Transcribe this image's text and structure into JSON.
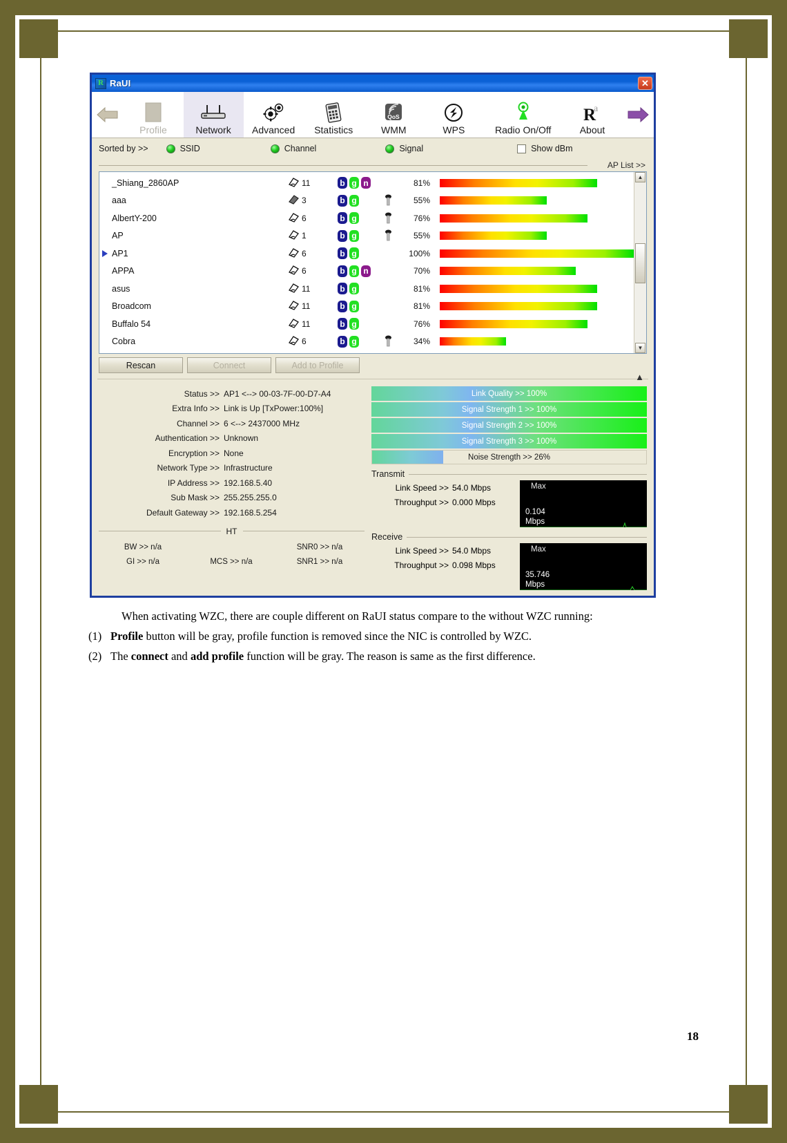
{
  "window": {
    "title": "RaUI",
    "icon": "raui-app-icon",
    "close_label": "✕"
  },
  "toolbar": {
    "back_icon": "back-arrow-icon",
    "forward_icon": "forward-arrow-icon",
    "items": [
      {
        "label": "Profile",
        "icon": "profile-icon",
        "state": "disabled"
      },
      {
        "label": "Network",
        "icon": "network-icon",
        "state": "selected"
      },
      {
        "label": "Advanced",
        "icon": "gear-icon",
        "state": "normal"
      },
      {
        "label": "Statistics",
        "icon": "statistics-icon",
        "state": "normal"
      },
      {
        "label": "WMM",
        "icon": "qos-icon",
        "state": "normal"
      },
      {
        "label": "WPS",
        "icon": "wps-icon",
        "state": "normal"
      },
      {
        "label": "Radio On/Off",
        "icon": "radio-icon",
        "state": "normal"
      },
      {
        "label": "About",
        "icon": "about-icon",
        "state": "normal"
      }
    ]
  },
  "sortbar": {
    "label": "Sorted by >>",
    "options": [
      "SSID",
      "Channel",
      "Signal"
    ],
    "show_dbm_label": "Show dBm",
    "show_dbm_checked": false
  },
  "aplist": {
    "legend": "AP List >>",
    "rows": [
      {
        "ssid": "_Shiang_2860AP",
        "channel": "11",
        "channel_icon": "wifi-channel-icon",
        "modes": [
          "b",
          "g",
          "n"
        ],
        "secured": false,
        "signal": "81%",
        "signal_pct": 81
      },
      {
        "ssid": "aaa",
        "channel": "3",
        "channel_icon": "adhoc-channel-icon",
        "modes": [
          "b",
          "g"
        ],
        "secured": true,
        "signal": "55%",
        "signal_pct": 55
      },
      {
        "ssid": "AlbertY-200",
        "channel": "6",
        "channel_icon": "wifi-channel-icon",
        "modes": [
          "b",
          "g"
        ],
        "secured": true,
        "signal": "76%",
        "signal_pct": 76
      },
      {
        "ssid": "AP",
        "channel": "1",
        "channel_icon": "wifi-channel-icon",
        "modes": [
          "b",
          "g"
        ],
        "secured": true,
        "signal": "55%",
        "signal_pct": 55
      },
      {
        "ssid": "AP1",
        "channel": "6",
        "channel_icon": "wifi-channel-icon",
        "modes": [
          "b",
          "g"
        ],
        "secured": false,
        "signal": "100%",
        "signal_pct": 100,
        "current": true
      },
      {
        "ssid": "APPA",
        "channel": "6",
        "channel_icon": "wifi-channel-icon",
        "modes": [
          "b",
          "g",
          "n"
        ],
        "secured": false,
        "signal": "70%",
        "signal_pct": 70
      },
      {
        "ssid": "asus",
        "channel": "11",
        "channel_icon": "wifi-channel-icon",
        "modes": [
          "b",
          "g"
        ],
        "secured": false,
        "signal": "81%",
        "signal_pct": 81
      },
      {
        "ssid": "Broadcom",
        "channel": "11",
        "channel_icon": "wifi-channel-icon",
        "modes": [
          "b",
          "g"
        ],
        "secured": false,
        "signal": "81%",
        "signal_pct": 81
      },
      {
        "ssid": "Buffalo 54",
        "channel": "11",
        "channel_icon": "wifi-channel-icon",
        "modes": [
          "b",
          "g"
        ],
        "secured": false,
        "signal": "76%",
        "signal_pct": 76
      },
      {
        "ssid": "Cobra",
        "channel": "6",
        "channel_icon": "wifi-channel-icon",
        "modes": [
          "b",
          "g"
        ],
        "secured": true,
        "signal": "34%",
        "signal_pct": 34
      }
    ]
  },
  "buttons": [
    {
      "label": "Rescan",
      "state": "enabled"
    },
    {
      "label": "Connect",
      "state": "disabled"
    },
    {
      "label": "Add to Profile",
      "state": "disabled"
    }
  ],
  "status": {
    "rows": [
      {
        "label": "Status >>",
        "value": "AP1 <--> 00-03-7F-00-D7-A4"
      },
      {
        "label": "Extra Info >>",
        "value": "Link is Up [TxPower:100%]"
      },
      {
        "label": "Channel >>",
        "value": "6 <--> 2437000 MHz"
      },
      {
        "label": "Authentication >>",
        "value": "Unknown"
      },
      {
        "label": "Encryption >>",
        "value": "None"
      },
      {
        "label": "Network Type >>",
        "value": "Infrastructure"
      },
      {
        "label": "IP Address >>",
        "value": "192.168.5.40"
      },
      {
        "label": "Sub Mask >>",
        "value": "255.255.255.0"
      },
      {
        "label": "Default Gateway >>",
        "value": "192.168.5.254"
      }
    ],
    "ht_divider": "HT",
    "ht": [
      [
        "BW >> n/a",
        "",
        "SNR0 >> n/a"
      ],
      [
        "GI >> n/a",
        "MCS >> n/a",
        "SNR1 >> n/a"
      ]
    ]
  },
  "quality": {
    "bars": [
      {
        "label": "Link Quality >> 100%",
        "value": 100,
        "style": "green"
      },
      {
        "label": "Signal Strength 1 >> 100%",
        "value": 100,
        "style": "green"
      },
      {
        "label": "Signal Strength 2 >> 100%",
        "value": 100,
        "style": "green"
      },
      {
        "label": "Signal Strength 3 >> 100%",
        "value": 100,
        "style": "green"
      },
      {
        "label": "Noise Strength >> 26%",
        "value": 26,
        "style": "noise"
      }
    ]
  },
  "transmit": {
    "heading": "Transmit",
    "link_speed_label": "Link Speed >>",
    "link_speed_value": "54.0 Mbps",
    "throughput_label": "Throughput >>",
    "throughput_value": "0.000 Mbps",
    "graph_max_label": "Max",
    "graph_value": "0.104",
    "graph_unit": "Mbps"
  },
  "receive": {
    "heading": "Receive",
    "link_speed_label": "Link Speed >>",
    "link_speed_value": "54.0 Mbps",
    "throughput_label": "Throughput >>",
    "throughput_value": "0.098 Mbps",
    "graph_max_label": "Max",
    "graph_value": "35.746",
    "graph_unit": "Mbps"
  },
  "document": {
    "paragraph": "When activating WZC, there are couple different on RaUI status compare to the without WZC running:",
    "items": [
      {
        "num": "(1)",
        "bold1": "Profile",
        "rest1": " button will be gray, profile function is removed since the NIC is controlled by WZC."
      },
      {
        "num": "(2)",
        "pre": "The ",
        "bold1": "connect",
        "mid": " and ",
        "bold2": "add profile",
        "rest": " function will be gray. The reason is same as the first difference."
      }
    ],
    "page_number": "18"
  },
  "colors": {
    "border": "#6b6530",
    "titlebar": "#0a62d8",
    "window_bg": "#ece9d8",
    "selected_tab": "#e9e7f2"
  }
}
